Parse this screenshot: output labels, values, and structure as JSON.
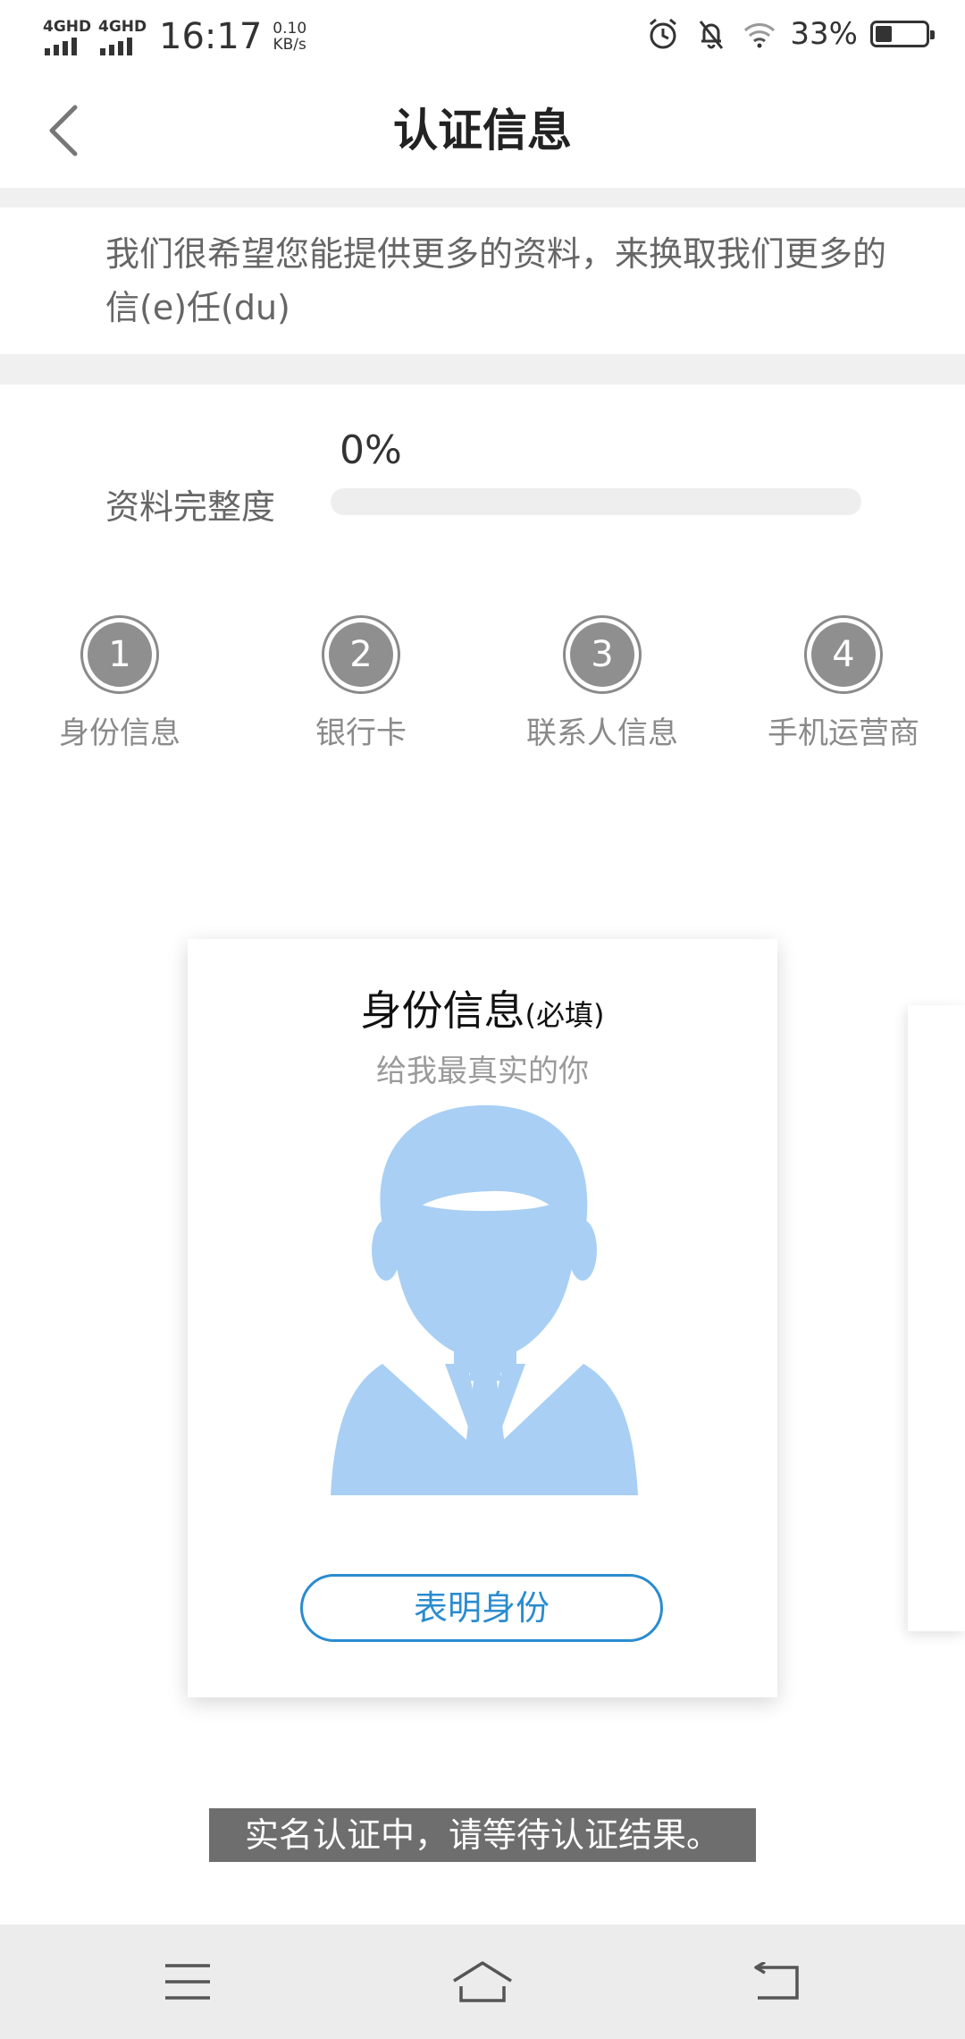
{
  "status_bar": {
    "network_1": "4GHD",
    "network_2": "4GHD",
    "time": "16:17",
    "speed_value": "0.10",
    "speed_unit": "KB/s",
    "battery_percent": "33%",
    "battery_level": 0.33
  },
  "header": {
    "title": "认证信息"
  },
  "intro": {
    "text": "我们很希望您能提供更多的资料，来换取我们更多的信(e)任(du)"
  },
  "progress": {
    "label": "资料完整度",
    "percent_text": "0%",
    "value": 0
  },
  "steps": [
    {
      "number": "1",
      "label": "身份信息"
    },
    {
      "number": "2",
      "label": "银行卡"
    },
    {
      "number": "3",
      "label": "联系人信息"
    },
    {
      "number": "4",
      "label": "手机运营商"
    }
  ],
  "card": {
    "title": "身份信息",
    "required": "(必填)",
    "subtitle": "给我最真实的你",
    "button": "表明身份"
  },
  "toast": {
    "text": "实名认证中，请等待认证结果。"
  },
  "colors": {
    "accent": "#2a8ccf",
    "avatar": "#a9cff4",
    "step_gray": "#8f8f8f"
  }
}
